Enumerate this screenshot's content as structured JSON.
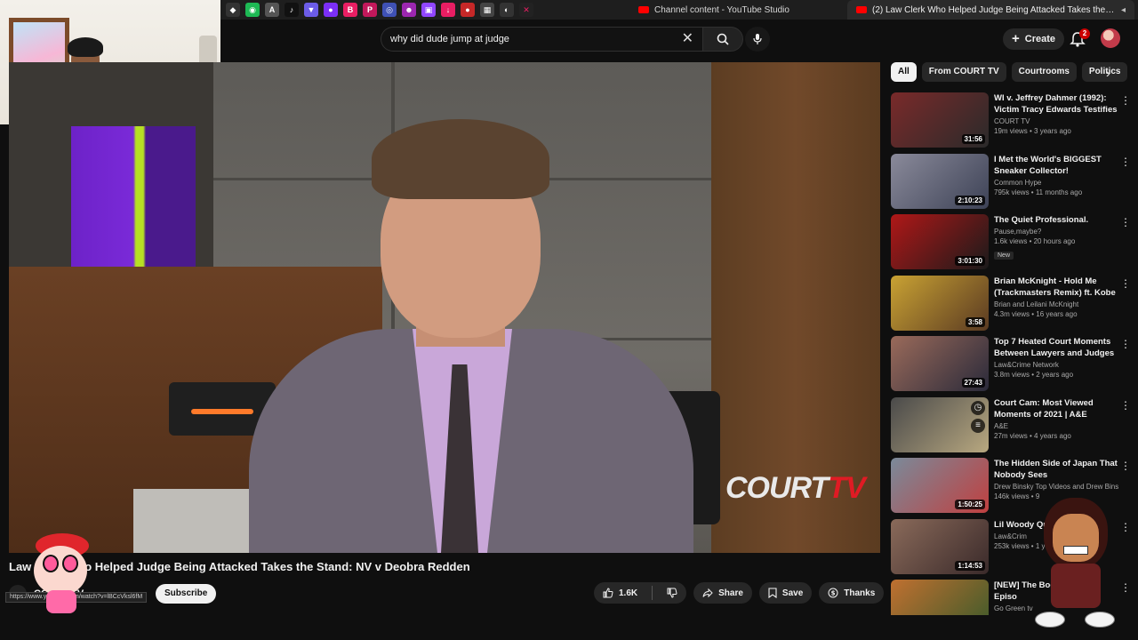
{
  "browser": {
    "pinned_icons": [
      "diamond-icon",
      "android-icon",
      "a-icon",
      "tiktok-icon",
      "shield-icon",
      "hat-icon",
      "b-icon",
      "pinterest-icon",
      "ring-icon",
      "alien-icon",
      "twitch-icon",
      "download-icon",
      "lock-icon",
      "nav-icon",
      "window-icon",
      "x-icon"
    ],
    "tabs": [
      {
        "label": "Channel content - YouTube Studio"
      },
      {
        "label": "(2) Law Clerk Who Helped Judge Being Attacked Takes the Stand:..."
      }
    ]
  },
  "header": {
    "search_value": "why did dude jump at judge",
    "create_label": "Create",
    "notifications_count": "2"
  },
  "video": {
    "logo_text": "COURT",
    "logo_tv": "TV",
    "title": "Law Clerk Who Helped Judge Being Attacked Takes the Stand: NV v Deobra Redden",
    "channel": "COURT TV",
    "subscribe_label": "Subscribe",
    "url_tooltip": "https://www.youtube.com/watch?v=lBCcVksl6fM",
    "likes": "1.6K",
    "share_label": "Share",
    "save_label": "Save",
    "thanks_label": "Thanks"
  },
  "filters": {
    "chips": [
      "All",
      "From COURT TV",
      "Courtrooms",
      "Politics"
    ]
  },
  "recommendations": [
    {
      "title": "WI v. Jeffrey Dahmer (1992): Victim Tracy Edwards Testifies",
      "channel": "COURT TV",
      "meta": "19m views • 3 years ago",
      "duration": "31:56",
      "badge": "",
      "colors": [
        "#7a2a2a",
        "#2a2a2a"
      ]
    },
    {
      "title": "I Met the World's BIGGEST Sneaker Collector!",
      "channel": "Common Hype",
      "meta": "795k views • 11 months ago",
      "duration": "2:10:23",
      "badge": "",
      "colors": [
        "#8a8a9a",
        "#3d4256"
      ]
    },
    {
      "title": "The Quiet Professional.",
      "channel": "Pause,maybe?",
      "meta": "1.6k views • 20 hours ago",
      "duration": "3:01:30",
      "badge": "New",
      "colors": [
        "#b01818",
        "#1a1a1a"
      ]
    },
    {
      "title": "Brian McKnight - Hold Me (Trackmasters Remix) ft. Kobe ...",
      "channel": "Brian and Leilani McKnight",
      "meta": "4.3m views • 16 years ago",
      "duration": "3:58",
      "badge": "",
      "colors": [
        "#c9a233",
        "#5a3a22"
      ]
    },
    {
      "title": "Top 7 Heated Court Moments Between Lawyers and Judges",
      "channel": "Law&Crime Network",
      "meta": "3.8m views • 2 years ago",
      "duration": "27:43",
      "badge": "",
      "colors": [
        "#9a6a5a",
        "#2a2a3a"
      ]
    },
    {
      "title": "Court Cam: Most Viewed Moments of 2021 | A&E",
      "channel": "A&E",
      "meta": "27m views • 4 years ago",
      "duration": "",
      "badge": "",
      "colors": [
        "#4a4a4a",
        "#b8a880"
      ]
    },
    {
      "title": "The Hidden Side of Japan That Nobody Sees",
      "channel": "Drew Binsky Top Videos and Drew Binsk...",
      "meta": "146k views • 9",
      "duration": "1:50:25",
      "badge": "",
      "colors": [
        "#7a8a9a",
        "#c04040"
      ]
    },
    {
      "title": "Lil Woody Question",
      "channel": "Law&Crim",
      "meta": "253k views • 1 year",
      "duration": "1:14:53",
      "badge": "",
      "colors": [
        "#8a6a5a",
        "#3a2a2a"
      ]
    },
    {
      "title": "[NEW] The Boo 2026 Full Episo",
      "channel": "Go Green tv",
      "meta": "",
      "duration": "",
      "badge": "",
      "colors": [
        "#c07030",
        "#3a5a2a"
      ]
    }
  ]
}
